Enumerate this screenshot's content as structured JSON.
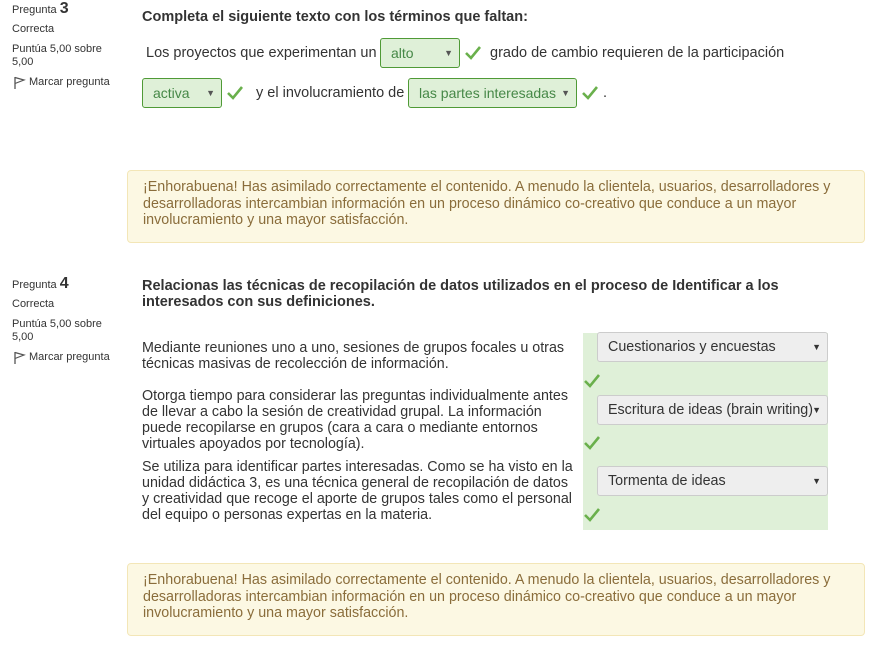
{
  "q3": {
    "info": {
      "label": "Pregunta",
      "number": "3",
      "state": "Correcta",
      "grade": "Puntúa 5,00 sobre 5,00",
      "flag": "Marcar pregunta"
    },
    "title": "Completa el siguiente texto con los términos que faltan:",
    "text1": "Los proyectos que experimentan un",
    "sel1": "alto",
    "text2": "grado de cambio requieren de la participación",
    "sel2": "activa",
    "text3": "y el involucramiento de",
    "sel3": "las partes interesadas",
    "text4": ".",
    "feedback": "¡Enhorabuena! Has asimilado correctamente el contenido. A menudo la clientela, usuarios, desarrolladores y desarrolladoras intercambian información en un proceso dinámico co-creativo que conduce a un mayor involucramiento y una mayor satisfacción."
  },
  "q4": {
    "info": {
      "label": "Pregunta",
      "number": "4",
      "state": "Correcta",
      "grade": "Puntúa 5,00 sobre 5,00",
      "flag": "Marcar pregunta"
    },
    "title": "Relacionas las técnicas de recopilación de datos utilizados en el proceso de Identificar a los interesados con sus definiciones.",
    "rows": [
      {
        "text": "Mediante reuniones uno a uno, sesiones de grupos focales u otras técnicas masivas de recolección de información.",
        "answer": "Cuestionarios y encuestas"
      },
      {
        "text": "Otorga tiempo para considerar las preguntas individualmente antes de llevar a cabo la sesión de creatividad grupal. La información puede recopilarse en grupos (cara a cara o mediante entornos virtuales apoyados por tecnología).",
        "answer": "Escritura de ideas (brain writing)"
      },
      {
        "text": "Se utiliza para identificar partes interesadas. Como se ha visto en la unidad didáctica 3, es una técnica general de recopilación de datos y creatividad que recoge el aporte de grupos tales como el personal del equipo o personas expertas en la materia.",
        "answer": "Tormenta de ideas"
      }
    ],
    "feedback": "¡Enhorabuena! Has asimilado correctamente el contenido. A menudo la clientela, usuarios, desarrolladores y desarrolladoras intercambian información en un proceso dinámico co-creativo que conduce a un mayor involucramiento y una mayor satisfacción."
  },
  "colors": {
    "correct": "#5cb85c",
    "select_bg": "#dff0d8",
    "feedback_bg": "#fcf8e3",
    "feedback_text": "#8a6d3b"
  },
  "icons": [
    "flag-icon",
    "check-icon",
    "dropdown-arrow-icon"
  ]
}
